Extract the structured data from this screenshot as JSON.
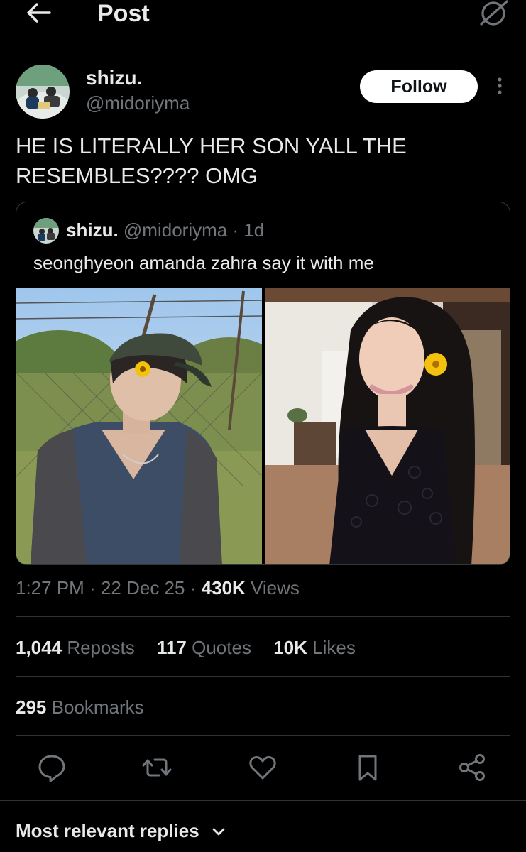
{
  "header": {
    "title": "Post"
  },
  "post": {
    "author_name": "shizu.",
    "author_handle": "@midoriyma",
    "follow_label": "Follow",
    "text": "HE IS LITERALLY HER SON YALL THE RESEMBLES???? OMG",
    "timestamp_time": "1:27 PM",
    "timestamp_date": "22 Dec 25",
    "views_count": "430K",
    "views_label": "Views"
  },
  "quote": {
    "author_name": "shizu.",
    "author_handle": "@midoriyma",
    "age": "1d",
    "text": "seonghyeon amanda zahra say it with me"
  },
  "stats": {
    "reposts_count": "1,044",
    "reposts_label": "Reposts",
    "quotes_count": "117",
    "quotes_label": "Quotes",
    "likes_count": "10K",
    "likes_label": "Likes",
    "bookmarks_count": "295",
    "bookmarks_label": "Bookmarks"
  },
  "actions": [
    "reply-icon",
    "repost-icon",
    "like-icon",
    "bookmark-icon",
    "share-icon"
  ],
  "replies": {
    "sort_label": "Most relevant replies"
  },
  "colors": {
    "background": "#000000",
    "text": "#e7e9ea",
    "muted": "#71767b",
    "border": "#2f3336"
  }
}
